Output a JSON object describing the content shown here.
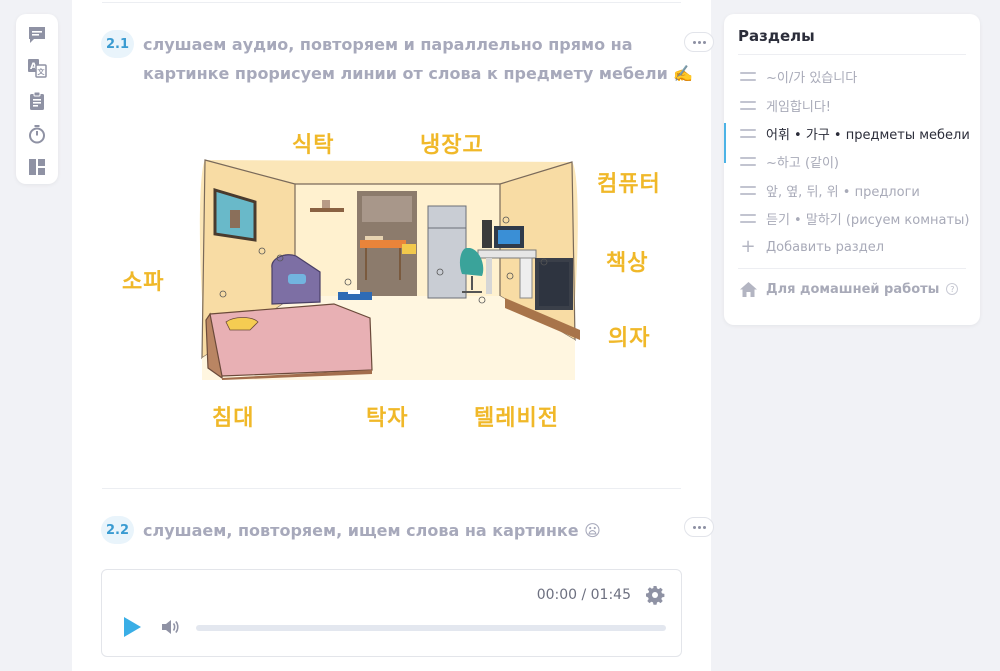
{
  "toolbar": {
    "items": [
      {
        "icon": "chat-icon"
      },
      {
        "icon": "translate-icon"
      },
      {
        "icon": "clipboard-icon"
      },
      {
        "icon": "timer-icon"
      },
      {
        "icon": "layout-icon"
      }
    ]
  },
  "main": {
    "sections": [
      {
        "num": "2.1",
        "title_line1": "слушаем аудио, повторяем и параллельно прямо на",
        "title_line2": "картинке прорисуем линии от слова к предмету мебели ✍️"
      },
      {
        "num": "2.2",
        "title": "слушаем, повторяем, ищем слова на картинке 😦"
      }
    ],
    "room_labels": {
      "siktak": "식탁",
      "naengjanggo": "냉장고",
      "keompyuteo": "컴퓨터",
      "chaeksang": "책상",
      "uija": "의자",
      "sofa": "소파",
      "chimdae": "침대",
      "takja": "탁자",
      "tellebijeon": "텔레비전"
    },
    "audio": {
      "time": "00:00 / 01:45",
      "progress": 0
    }
  },
  "sections_panel": {
    "title": "Разделы",
    "items": [
      {
        "label": "~이/가 있습니다"
      },
      {
        "label": "게임합니다!"
      },
      {
        "label": "어휘 • 가구 • предметы мебели"
      },
      {
        "label": "~하고 (같이)"
      },
      {
        "label": "앞, 옆, 뒤, 위 • предлоги"
      },
      {
        "label": "듣기 • 말하기 (рисуем комнаты)"
      }
    ],
    "add_label": "Добавить раздел",
    "homework_label": "Для домашней работы",
    "help": "?"
  },
  "colors": {
    "accent": "#4cb3e6",
    "korean_label": "#f0b829",
    "muted_text": "#a8aab8"
  }
}
